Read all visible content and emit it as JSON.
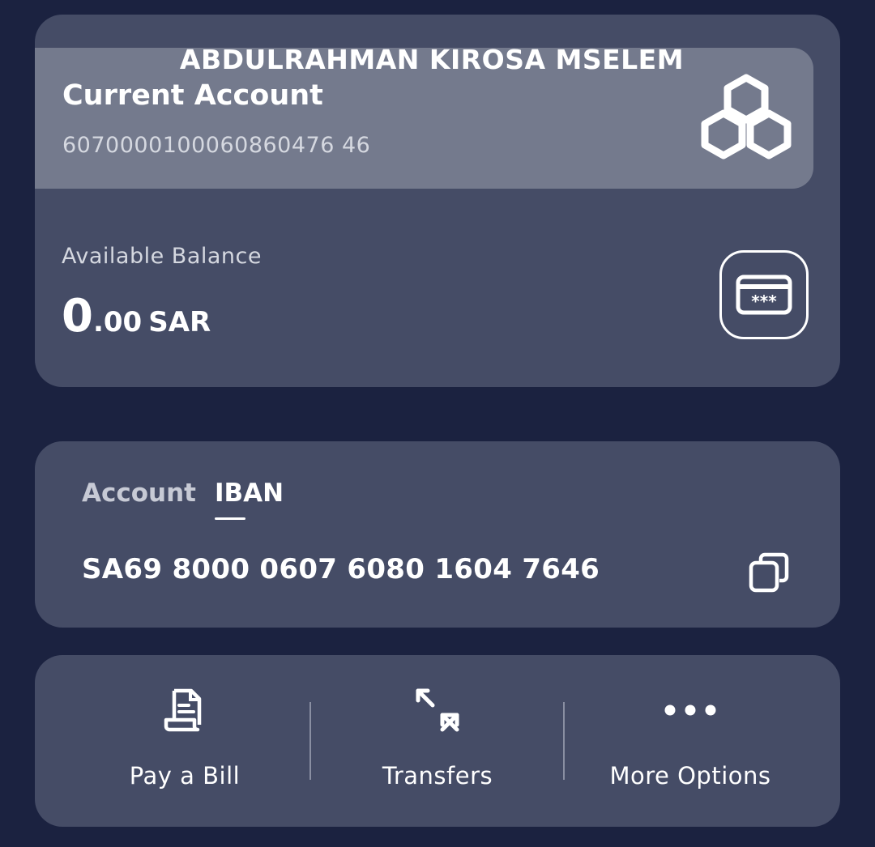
{
  "account": {
    "holder_name": "ABDULRAHMAN KIROSA MSELEM",
    "type": "Current Account",
    "number": "6070000100060860476 46",
    "logo_icon": "bank-hexagon-logo-icon"
  },
  "balance": {
    "label": "Available Balance",
    "integer": "0",
    "decimal": ".00",
    "currency": "SAR",
    "card_button_icon": "masked-card-icon"
  },
  "identifiers": {
    "tabs": [
      {
        "label": "Account",
        "active": false
      },
      {
        "label": "IBAN",
        "active": true
      }
    ],
    "iban": "SA69 8000 0607 6080 1604 7646",
    "copy_icon": "copy-icon"
  },
  "actions": [
    {
      "label": "Pay a Bill",
      "icon": "bill-icon"
    },
    {
      "label": "Transfers",
      "icon": "transfer-arrows-icon"
    },
    {
      "label": "More Options",
      "icon": "more-dots-icon"
    }
  ],
  "colors": {
    "background": "#1b2240",
    "card": "#454c66",
    "header_band": "#747a8d",
    "text": "#ffffff",
    "muted_text": "#d5d8e0"
  }
}
